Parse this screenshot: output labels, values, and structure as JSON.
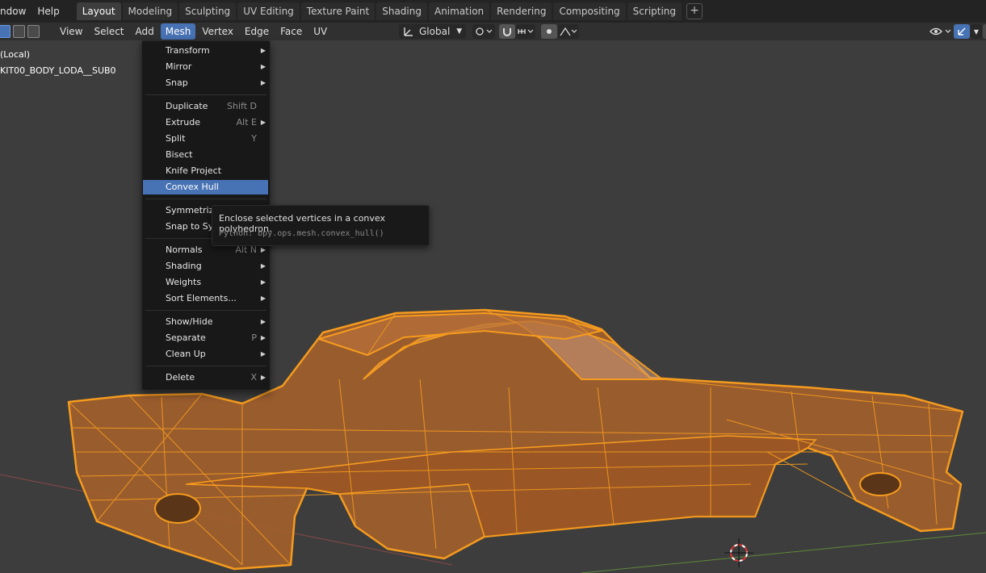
{
  "app_menu": [
    "ndow",
    "Help"
  ],
  "workspaces": [
    "Layout",
    "Modeling",
    "Sculpting",
    "UV Editing",
    "Texture Paint",
    "Shading",
    "Animation",
    "Rendering",
    "Compositing",
    "Scripting"
  ],
  "active_workspace": "Layout",
  "add_workspace_label": "+",
  "header_menus": [
    "View",
    "Select",
    "Add",
    "Mesh",
    "Vertex",
    "Edge",
    "Face",
    "UV"
  ],
  "open_menu": "Mesh",
  "transform_orientation": "Global",
  "viewport_info": {
    "line1": "(Local)",
    "line2": "KIT00_BODY_LODA__SUB0"
  },
  "mesh_menu": {
    "items": [
      {
        "label": "Transform",
        "shortcut": "",
        "submenu": true
      },
      {
        "label": "Mirror",
        "shortcut": "",
        "submenu": true
      },
      {
        "label": "Snap",
        "shortcut": "",
        "submenu": true
      },
      {
        "label": "Duplicate",
        "shortcut": "Shift D",
        "submenu": false
      },
      {
        "label": "Extrude",
        "shortcut": "Alt E",
        "submenu": true
      },
      {
        "label": "Split",
        "shortcut": "Y",
        "submenu": false
      },
      {
        "label": "Bisect",
        "shortcut": "",
        "submenu": false
      },
      {
        "label": "Knife Project",
        "shortcut": "",
        "submenu": false
      },
      {
        "label": "Convex Hull",
        "shortcut": "",
        "submenu": false,
        "highlighted": true
      },
      {
        "label": "Symmetriz",
        "shortcut": "",
        "submenu": false
      },
      {
        "label": "Snap to Sy",
        "shortcut": "",
        "submenu": false
      },
      {
        "label": "Normals",
        "shortcut": "Alt N",
        "submenu": true
      },
      {
        "label": "Shading",
        "shortcut": "",
        "submenu": true
      },
      {
        "label": "Weights",
        "shortcut": "",
        "submenu": true
      },
      {
        "label": "Sort Elements...",
        "shortcut": "",
        "submenu": true
      },
      {
        "label": "Show/Hide",
        "shortcut": "",
        "submenu": true
      },
      {
        "label": "Separate",
        "shortcut": "P",
        "submenu": true
      },
      {
        "label": "Clean Up",
        "shortcut": "",
        "submenu": true
      },
      {
        "label": "Delete",
        "shortcut": "X",
        "submenu": true
      }
    ]
  },
  "tooltip": {
    "description": "Enclose selected vertices in a convex polyhedron.",
    "python": "Python: bpy.ops.mesh.convex_hull()"
  },
  "colors": {
    "accent": "#4772b3",
    "mesh_wire": "#f59b1e",
    "mesh_face": "#a9622a",
    "background": "#3d3d3d"
  }
}
